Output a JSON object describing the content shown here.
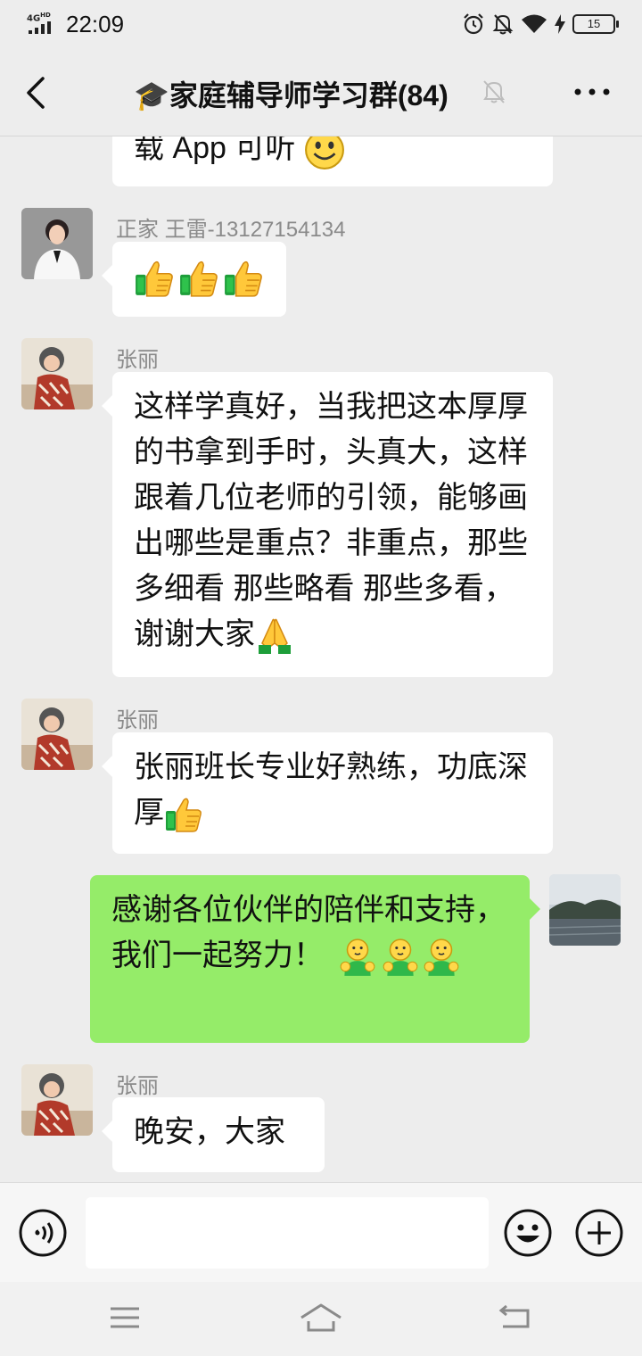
{
  "status_bar": {
    "network": "4G",
    "network_sup": "HD",
    "time": "22:09",
    "battery": "15"
  },
  "header": {
    "title": "🎓家庭辅导师学习群(84)"
  },
  "messages": [
    {
      "text": "载 App 可听"
    },
    {
      "sender": "正家 王雷-13127154134"
    },
    {
      "sender": "张丽",
      "text": "这样学真好，当我把这本厚厚的书拿到手时，头真大，这样跟着几位老师的引领，能够画出哪些是重点？非重点，那些多细看 那些略看 那些多看，谢谢大家"
    },
    {
      "sender": "张丽",
      "text": "张丽班长专业好熟练，功底深厚"
    },
    {
      "text": "感谢各位伙伴的陪伴和支持，我们一起努力！"
    },
    {
      "sender": "张丽",
      "text": "晚安，大家"
    }
  ],
  "colors": {
    "background": "#ededed",
    "bubble_self": "#95ec69",
    "bubble_other": "#ffffff",
    "sender_name": "#8a8a8a"
  },
  "icons": [
    "back-arrow-icon",
    "mute-bell-icon",
    "more-dots-icon",
    "voice-icon",
    "emoji-face-icon",
    "plus-icon",
    "menu-icon",
    "home-icon",
    "return-icon",
    "smile-emoji",
    "thumbs-up-emoji",
    "pray-emoji",
    "hug-emoji"
  ]
}
